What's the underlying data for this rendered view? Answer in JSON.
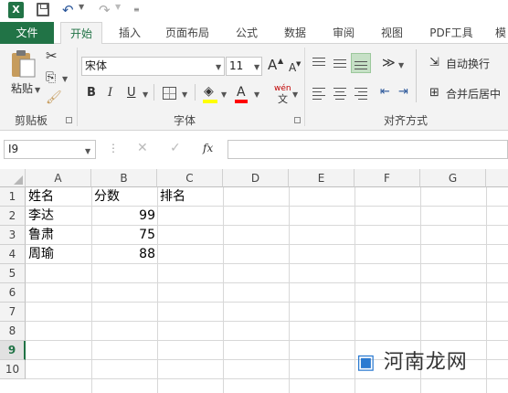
{
  "quick_access": {
    "app_icon_text": "X"
  },
  "tabs": [
    {
      "label": "文件"
    },
    {
      "label": "开始"
    },
    {
      "label": "插入"
    },
    {
      "label": "页面布局"
    },
    {
      "label": "公式"
    },
    {
      "label": "数据"
    },
    {
      "label": "审阅"
    },
    {
      "label": "视图"
    },
    {
      "label": "PDF工具"
    },
    {
      "label": "模"
    }
  ],
  "ribbon": {
    "clipboard": {
      "paste_label": "粘贴",
      "group_label": "剪贴板"
    },
    "font": {
      "font_name": "宋体",
      "font_size": "11",
      "bold": "B",
      "italic": "I",
      "underline": "U",
      "grow": "A",
      "shrink": "A",
      "font_color": "A",
      "phonetic": "wén",
      "phonetic_sub": "文",
      "group_label": "字体"
    },
    "alignment": {
      "wrap_text": "自动换行",
      "merge_center": "合并后居中",
      "group_label": "对齐方式"
    }
  },
  "formula_bar": {
    "name_box": "I9",
    "fx": "fx",
    "content": ""
  },
  "sheet": {
    "columns": [
      "A",
      "B",
      "C",
      "D",
      "E",
      "F",
      "G"
    ],
    "rows": [
      "1",
      "2",
      "3",
      "4",
      "5",
      "6",
      "7",
      "8",
      "9",
      "10"
    ],
    "selected_row": "9",
    "cells": {
      "A1": "姓名",
      "B1": "分数",
      "C1": "排名",
      "A2": "李达",
      "B2": "99",
      "A3": "鲁肃",
      "B3": "75",
      "A4": "周瑜",
      "B4": "88"
    }
  },
  "watermark": {
    "text": "河南龙网"
  },
  "colors": {
    "accent": "#217346",
    "ribbon_bg": "#f3f3f3"
  }
}
